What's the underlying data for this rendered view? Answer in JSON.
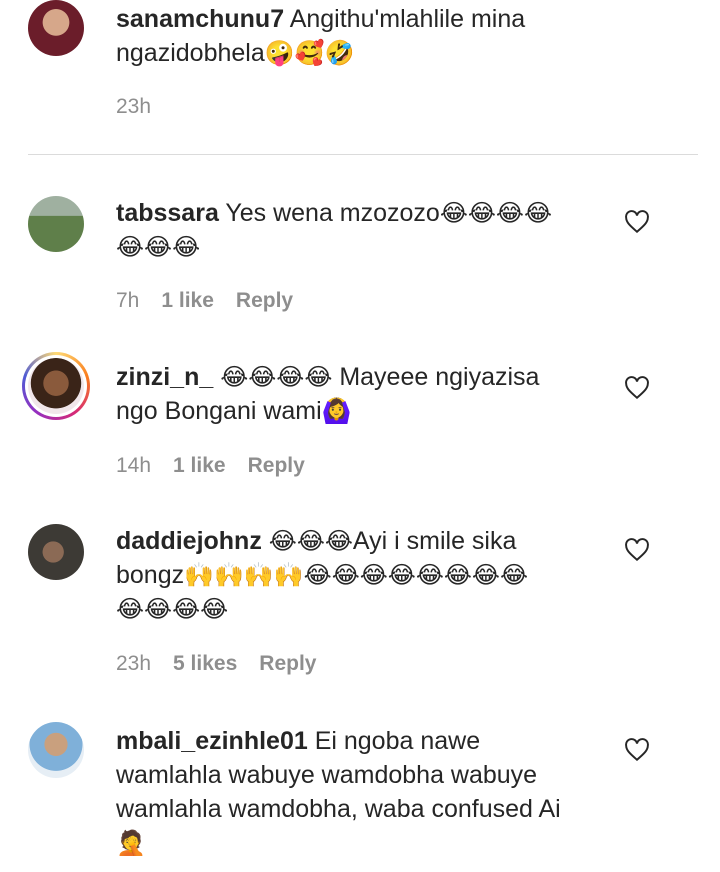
{
  "comments": [
    {
      "username": "sanamchunu7",
      "text_line1": "Angithu'mlahlile mina",
      "text_line2": "ngazidobhela",
      "emoji_line2": "🤪🥰🤣",
      "time": "23h"
    },
    {
      "username": "tabssara",
      "text_line1": "Yes wena mzozozo",
      "emoji_line1": "😂😂😂😂",
      "emoji_line2": "😂😂😂",
      "time": "7h",
      "likes": "1 like",
      "reply": "Reply"
    },
    {
      "username": "zinzi_n_",
      "emoji_line1": "😂😂😂😂",
      "text_line1": "Mayeee ngiyazisa",
      "text_line2": "ngo Bongani wami",
      "emoji_line2": "🙆‍♀️",
      "time": "14h",
      "likes": "1 like",
      "reply": "Reply"
    },
    {
      "username": "daddiejohnz",
      "emoji_line1": "😂😂😂",
      "text_line1": "Ayi i smile sika",
      "text_line2": "bongz",
      "emoji_line2": "🙌🙌🙌🙌😂😂😂😂😂😂😂😂",
      "emoji_line3": "😂😂😂😂",
      "time": "23h",
      "likes": "5 likes",
      "reply": "Reply"
    },
    {
      "username": "mbali_ezinhle01",
      "text_line1": "Ei ngoba nawe",
      "text_line2": "wamlahla wabuye wamdobha wabuye",
      "text_line3": "wamlahla wamdobha, waba confused Ai",
      "emoji_line4": "🤦"
    }
  ],
  "icons": {
    "like": "heart-outline-icon"
  }
}
